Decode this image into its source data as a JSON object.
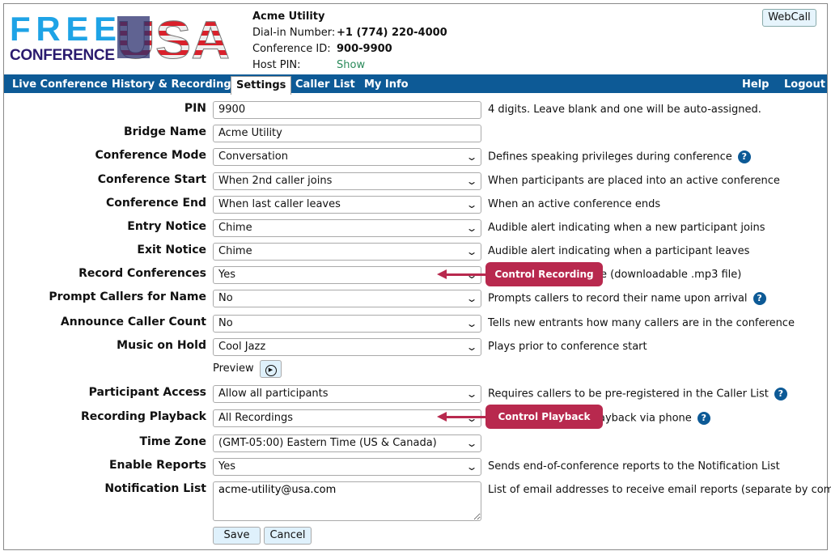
{
  "header": {
    "account": "Acme Utility",
    "dial_label": "Dial-in Number:",
    "dial_value": "+1 (774) 220-4000",
    "conf_label": "Conference ID:",
    "conf_value": "900-9900",
    "pin_label": "Host PIN:",
    "pin_link": "Show",
    "webcall": "WebCall",
    "logo_text": "FREE CONFERENCE USA"
  },
  "nav": {
    "tabs": [
      "Live Conference",
      "History & Recordings",
      "Settings",
      "Caller List",
      "My Info"
    ],
    "active": "Settings",
    "right": [
      "Help",
      "Logout"
    ]
  },
  "fields": [
    {
      "label": "PIN",
      "type": "text",
      "value": "9900",
      "desc": "4 digits. Leave blank and one will be auto-assigned."
    },
    {
      "label": "Bridge Name",
      "type": "text",
      "value": "Acme Utility",
      "desc": ""
    },
    {
      "label": "Conference Mode",
      "type": "select",
      "value": "Conversation",
      "desc": "Defines speaking privileges during conference",
      "help": true
    },
    {
      "label": "Conference Start",
      "type": "select",
      "value": "When 2nd caller joins",
      "desc": "When participants are placed into an active conference"
    },
    {
      "label": "Conference End",
      "type": "select",
      "value": "When last caller leaves",
      "desc": "When an active conference ends"
    },
    {
      "label": "Entry Notice",
      "type": "select",
      "value": "Chime",
      "desc": "Audible alert indicating when a new participant joins"
    },
    {
      "label": "Exit Notice",
      "type": "select",
      "value": "Chime",
      "desc": "Audible alert indicating when a participant leaves"
    },
    {
      "label": "Record Conferences",
      "type": "select",
      "value": "Yes",
      "desc": "e (downloadable .mp3 file)"
    },
    {
      "label": "Prompt Callers for Name",
      "type": "select",
      "value": "No",
      "desc": "Prompts callers to record their name upon arrival",
      "help": true
    },
    {
      "label": "Announce Caller Count",
      "type": "select",
      "value": "No",
      "desc": "Tells new entrants how many callers are in the conference"
    },
    {
      "label": "Music on Hold",
      "type": "select",
      "value": "Cool Jazz",
      "desc": "Plays prior to conference start"
    },
    {
      "label": "Participant Access",
      "type": "select",
      "value": "Allow all participants",
      "desc": "Requires callers to be pre-registered in the Caller List",
      "help": true
    },
    {
      "label": "Recording Playback",
      "type": "select",
      "value": "All Recordings",
      "desc": "ayback via phone",
      "help": true
    },
    {
      "label": "Time Zone",
      "type": "select",
      "value": "(GMT-05:00) Eastern Time (US & Canada)",
      "desc": ""
    },
    {
      "label": "Enable Reports",
      "type": "select",
      "value": "Yes",
      "desc": "Sends end-of-conference reports to the Notification List"
    },
    {
      "label": "Notification List",
      "type": "textarea",
      "value": "acme-utility@usa.com",
      "desc": "List of email addresses to receive email reports (separate by comma)"
    }
  ],
  "preview_label": "Preview",
  "buttons": {
    "save": "Save",
    "cancel": "Cancel"
  },
  "callouts": [
    "Control Recording",
    "Control Playback"
  ],
  "colors": {
    "nav": "#0d5a96",
    "callout": "#b8294e",
    "link": "#2a8a5a"
  }
}
